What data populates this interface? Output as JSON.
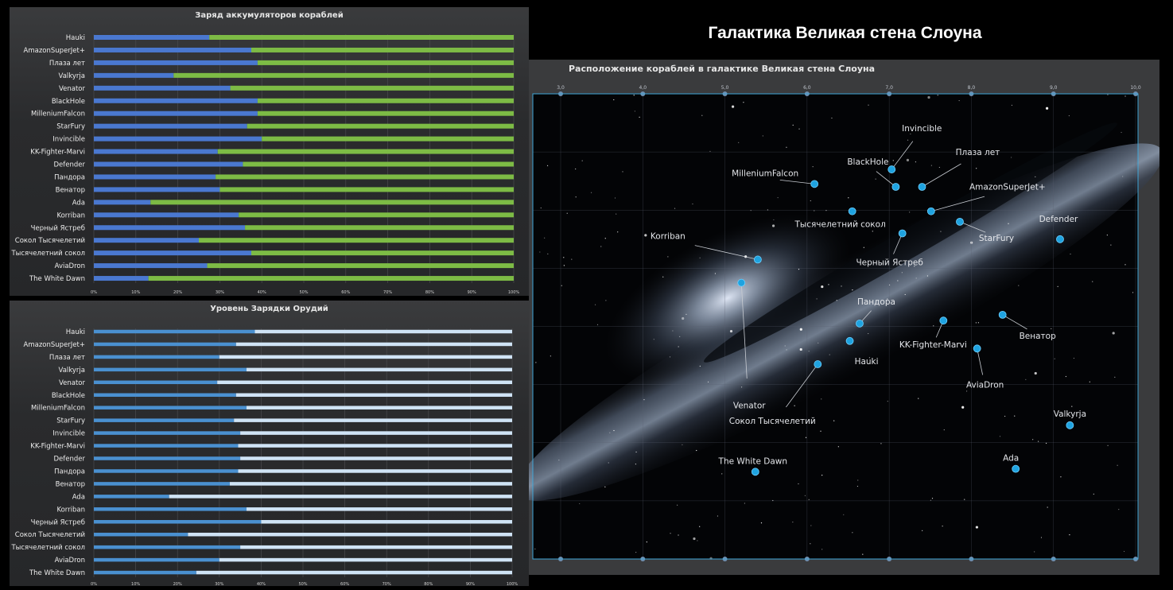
{
  "page_title": "Галактика Великая стена Слоуна",
  "chart_data": [
    {
      "type": "bar",
      "stacked_percent": true,
      "title": "Заряд аккумуляторов кораблей",
      "categories": [
        "Hauki",
        "AmazonSuperJet+",
        "Плаза лет",
        "Valkyrja",
        "Venator",
        "BlackHole",
        "MilleniumFalcon",
        "StarFury",
        "Invincible",
        "KK-Fighter-Marvi",
        "Defender",
        "Пандора",
        "Венатор",
        "Ada",
        "Korriban",
        "Черный Ястреб",
        "Сокол Тысячелетий",
        "Тысячелетний сокол",
        "AviaDron",
        "The White Dawn"
      ],
      "series": [
        {
          "values": [
            27.5,
            37.5,
            39,
            19,
            32.5,
            39,
            39,
            36.5,
            40,
            29.5,
            35.5,
            29,
            30,
            13.5,
            34.5,
            36,
            25,
            37.5,
            27,
            13
          ]
        },
        {
          "values": [
            72.5,
            62.5,
            61,
            81,
            67.5,
            61,
            61,
            63.5,
            60,
            70.5,
            64.5,
            71,
            70,
            86.5,
            65.5,
            64,
            75,
            62.5,
            73,
            87
          ]
        }
      ],
      "colors": [
        "#4a78d0",
        "#7dbb45"
      ],
      "xlim": [
        0,
        100
      ],
      "x_ticks": [
        "0%",
        "10%",
        "20%",
        "30%",
        "40%",
        "50%",
        "60%",
        "70%",
        "80%",
        "90%",
        "100%"
      ]
    },
    {
      "type": "bar",
      "stacked_percent": true,
      "title": "Уровень Зарядки Орудий",
      "categories": [
        "Hauki",
        "AmazonSuperJet+",
        "Плаза лет",
        "Valkyrja",
        "Venator",
        "BlackHole",
        "MilleniumFalcon",
        "StarFury",
        "Invincible",
        "KK-Fighter-Marvi",
        "Defender",
        "Пандора",
        "Венатор",
        "Ada",
        "Korriban",
        "Черный Ястреб",
        "Сокол Тысячелетий",
        "Тысячелетний сокол",
        "AviaDron",
        "The White Dawn"
      ],
      "series": [
        {
          "values": [
            38.5,
            34,
            30,
            36.5,
            29.5,
            34,
            36.5,
            33.5,
            35,
            34.5,
            35,
            34.5,
            32.5,
            18,
            36.5,
            40,
            22.5,
            35,
            30,
            24.5
          ]
        },
        {
          "values": [
            61.5,
            66,
            70,
            63.5,
            70.5,
            66,
            63.5,
            66.5,
            65,
            65.5,
            65,
            65.5,
            67.5,
            82,
            63.5,
            60,
            77.5,
            65,
            70,
            75.5
          ]
        }
      ],
      "colors": [
        "#4a90d0",
        "#cfe3f5"
      ],
      "xlim": [
        0,
        100
      ],
      "x_ticks": [
        "0%",
        "10%",
        "20%",
        "30%",
        "40%",
        "50%",
        "60%",
        "70%",
        "80%",
        "90%",
        "100%"
      ]
    },
    {
      "type": "scatter",
      "title": "Расположение кораблей в галактике Великая стена Слоуна",
      "x_ticks": [
        "3,0",
        "4,0",
        "5,0",
        "6,0",
        "7,0",
        "8,0",
        "9,0",
        "10,0"
      ],
      "xlim": [
        3,
        10
      ],
      "ylim": [
        0,
        8
      ],
      "grid": true,
      "point_color": "#1fa3e0",
      "points": [
        {
          "label": "Invincible",
          "x": 7.03,
          "y": 6.7
        },
        {
          "label": "BlackHole",
          "x": 7.08,
          "y": 6.4
        },
        {
          "label": "Плаза лет",
          "x": 7.4,
          "y": 6.4
        },
        {
          "label": "MilleniumFalcon",
          "x": 6.09,
          "y": 6.45
        },
        {
          "label": "AmazonSuperJet+",
          "x": 7.51,
          "y": 5.98
        },
        {
          "label": "Тысячелетний сокол",
          "x": 6.55,
          "y": 5.98
        },
        {
          "label": "StarFury",
          "x": 7.86,
          "y": 5.8
        },
        {
          "label": "Defender",
          "x": 9.08,
          "y": 5.5
        },
        {
          "label": "Черный Ястреб",
          "x": 7.16,
          "y": 5.6
        },
        {
          "label": "Korriban",
          "x": 5.4,
          "y": 5.15
        },
        {
          "label": "Venator",
          "x": 5.2,
          "y": 4.75
        },
        {
          "label": "Пандора",
          "x": 6.64,
          "y": 4.05
        },
        {
          "label": "Венатор",
          "x": 8.38,
          "y": 4.2
        },
        {
          "label": "KK-Fighter-Marvi",
          "x": 7.66,
          "y": 4.1
        },
        {
          "label": "Hauki",
          "x": 6.52,
          "y": 3.75
        },
        {
          "label": "AviaDron",
          "x": 8.07,
          "y": 3.62
        },
        {
          "label": "Сокол Тысячелетий",
          "x": 6.13,
          "y": 3.35
        },
        {
          "label": "Valkyrja",
          "x": 9.2,
          "y": 2.3
        },
        {
          "label": "Ada",
          "x": 8.54,
          "y": 1.55
        },
        {
          "label": "The White Dawn",
          "x": 5.37,
          "y": 1.5
        }
      ]
    }
  ]
}
